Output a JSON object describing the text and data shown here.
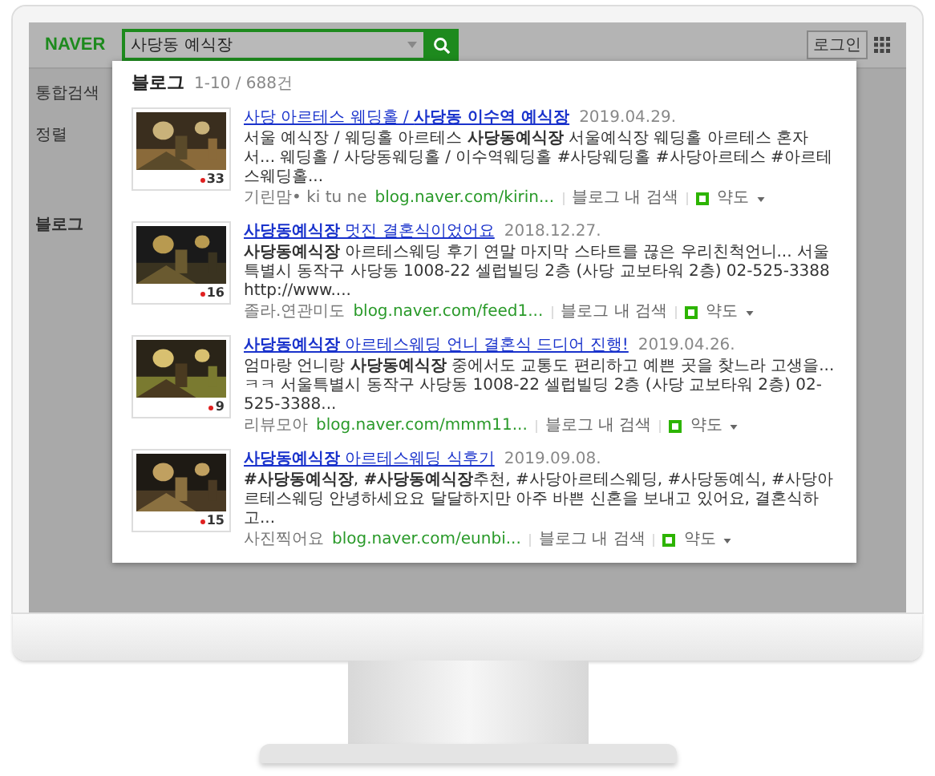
{
  "page": {
    "logo": "NAVER",
    "search": {
      "value": "사당동 예식장"
    },
    "login": "로그인",
    "nav_item": "통합검색",
    "sort": "정렬",
    "section": "블로그"
  },
  "popup": {
    "title": "블로그",
    "range": "1-10 / 688건",
    "results": [
      {
        "kind": "picture",
        "title": "사당 아르테스 웨딩홀 / **사당동 이수역 예식장**",
        "date": "2019.04.29.",
        "description": "서울 예식장 / 웨딩홀 아르테스 **사당동예식장** 서울예식장 웨딩홀 아르테스 혼자서... 웨딩홀 / 사당동웨딩홀 / 이수역웨딩홀 #사당웨딩홀 #사당아르테스 #아르테스웨딩홀...",
        "author": "기린맘• ki tu ne",
        "url": "blog.naver.com/kirin...",
        "count": "33",
        "search_label": "블로그 내 검색",
        "map_label": "약도"
      },
      {
        "kind": "picture",
        "title": "**사당동예식장** 멋진 결혼식이었어요",
        "date": "2018.12.27.",
        "description": "**사당동예식장** 아르테스웨딩 후기 연말 마지막 스타트를 끊은 우리친척언니... 서울특별시 동작구 사당동 1008-22 셀럽빌딩 2층 (사당 교보타워 2층) 02-525-3388 http://www....",
        "author": "졸라.연관미도",
        "url": "blog.naver.com/feed1...",
        "count": "16",
        "search_label": "블로그 내 검색",
        "map_label": "약도"
      },
      {
        "kind": "picture",
        "title": "**사당동예식장** 아르테스웨딩 언니 결혼식 드디어 진행!",
        "date": "2019.04.26.",
        "description": "엄마랑 언니랑 **사당동예식장** 중에서도 교통도 편리하고 예쁜 곳을 찾느라 고생을... ㅋㅋ 서울특별시 동작구 사당동 1008-22 셀럽빌딩 2층 (사당 교보타워 2층) 02-525-3388...",
        "author": "리뷰모아",
        "url": "blog.naver.com/mmm11...",
        "count": "9",
        "search_label": "블로그 내 검색",
        "map_label": "약도"
      },
      {
        "kind": "picture",
        "title": "**사당동예식장** 아르테스웨딩 식후기",
        "date": "2019.09.08.",
        "description": "**#사당동예식장**, **#사당동예식장**추천, #사당아르테스웨딩, #사당동예식, #사당아르테스웨딩 안녕하세요요 달달하지만 아주 바쁜 신혼을 보내고 있어요, 결혼식하고...",
        "author": "사진찍어요",
        "url": "blog.naver.com/eunbi...",
        "count": "15",
        "search_label": "블로그 내 검색",
        "map_label": "약도"
      }
    ]
  }
}
